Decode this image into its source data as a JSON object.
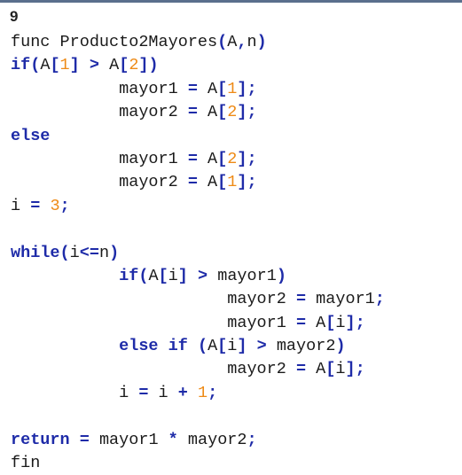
{
  "exercise_number": "9",
  "code_lines": [
    {
      "tokens": [
        {
          "t": "func Producto2Mayores",
          "c": "plain"
        },
        {
          "t": "(",
          "c": "op"
        },
        {
          "t": "A",
          "c": "plain"
        },
        {
          "t": ",",
          "c": "op"
        },
        {
          "t": "n",
          "c": "plain"
        },
        {
          "t": ")",
          "c": "op"
        }
      ]
    },
    {
      "tokens": [
        {
          "t": "if",
          "c": "kw"
        },
        {
          "t": "(",
          "c": "op"
        },
        {
          "t": "A",
          "c": "plain"
        },
        {
          "t": "[",
          "c": "op"
        },
        {
          "t": "1",
          "c": "num"
        },
        {
          "t": "]",
          "c": "op"
        },
        {
          "t": " ",
          "c": "plain"
        },
        {
          "t": ">",
          "c": "op"
        },
        {
          "t": " A",
          "c": "plain"
        },
        {
          "t": "[",
          "c": "op"
        },
        {
          "t": "2",
          "c": "num"
        },
        {
          "t": "])",
          "c": "op"
        }
      ]
    },
    {
      "tokens": [
        {
          "t": "           mayor1 ",
          "c": "plain"
        },
        {
          "t": "=",
          "c": "op"
        },
        {
          "t": " A",
          "c": "plain"
        },
        {
          "t": "[",
          "c": "op"
        },
        {
          "t": "1",
          "c": "num"
        },
        {
          "t": "];",
          "c": "op"
        }
      ]
    },
    {
      "tokens": [
        {
          "t": "           mayor2 ",
          "c": "plain"
        },
        {
          "t": "=",
          "c": "op"
        },
        {
          "t": " A",
          "c": "plain"
        },
        {
          "t": "[",
          "c": "op"
        },
        {
          "t": "2",
          "c": "num"
        },
        {
          "t": "];",
          "c": "op"
        }
      ]
    },
    {
      "tokens": [
        {
          "t": "else",
          "c": "kw"
        }
      ]
    },
    {
      "tokens": [
        {
          "t": "           mayor1 ",
          "c": "plain"
        },
        {
          "t": "=",
          "c": "op"
        },
        {
          "t": " A",
          "c": "plain"
        },
        {
          "t": "[",
          "c": "op"
        },
        {
          "t": "2",
          "c": "num"
        },
        {
          "t": "];",
          "c": "op"
        }
      ]
    },
    {
      "tokens": [
        {
          "t": "           mayor2 ",
          "c": "plain"
        },
        {
          "t": "=",
          "c": "op"
        },
        {
          "t": " A",
          "c": "plain"
        },
        {
          "t": "[",
          "c": "op"
        },
        {
          "t": "1",
          "c": "num"
        },
        {
          "t": "];",
          "c": "op"
        }
      ]
    },
    {
      "tokens": [
        {
          "t": "i ",
          "c": "plain"
        },
        {
          "t": "=",
          "c": "op"
        },
        {
          "t": " ",
          "c": "plain"
        },
        {
          "t": "3",
          "c": "num"
        },
        {
          "t": ";",
          "c": "op"
        }
      ]
    },
    {
      "tokens": []
    },
    {
      "tokens": [
        {
          "t": "while",
          "c": "kw"
        },
        {
          "t": "(",
          "c": "op"
        },
        {
          "t": "i",
          "c": "plain"
        },
        {
          "t": "<=",
          "c": "op"
        },
        {
          "t": "n",
          "c": "plain"
        },
        {
          "t": ")",
          "c": "op"
        }
      ]
    },
    {
      "tokens": [
        {
          "t": "           ",
          "c": "plain"
        },
        {
          "t": "if",
          "c": "kw"
        },
        {
          "t": "(",
          "c": "op"
        },
        {
          "t": "A",
          "c": "plain"
        },
        {
          "t": "[",
          "c": "op"
        },
        {
          "t": "i",
          "c": "plain"
        },
        {
          "t": "]",
          "c": "op"
        },
        {
          "t": " ",
          "c": "plain"
        },
        {
          "t": ">",
          "c": "op"
        },
        {
          "t": " mayor1",
          "c": "plain"
        },
        {
          "t": ")",
          "c": "op"
        }
      ]
    },
    {
      "tokens": [
        {
          "t": "                      mayor2 ",
          "c": "plain"
        },
        {
          "t": "=",
          "c": "op"
        },
        {
          "t": " mayor1",
          "c": "plain"
        },
        {
          "t": ";",
          "c": "op"
        }
      ]
    },
    {
      "tokens": [
        {
          "t": "                      mayor1 ",
          "c": "plain"
        },
        {
          "t": "=",
          "c": "op"
        },
        {
          "t": " A",
          "c": "plain"
        },
        {
          "t": "[",
          "c": "op"
        },
        {
          "t": "i",
          "c": "plain"
        },
        {
          "t": "];",
          "c": "op"
        }
      ]
    },
    {
      "tokens": [
        {
          "t": "           ",
          "c": "plain"
        },
        {
          "t": "else if",
          "c": "kw"
        },
        {
          "t": " ",
          "c": "plain"
        },
        {
          "t": "(",
          "c": "op"
        },
        {
          "t": "A",
          "c": "plain"
        },
        {
          "t": "[",
          "c": "op"
        },
        {
          "t": "i",
          "c": "plain"
        },
        {
          "t": "]",
          "c": "op"
        },
        {
          "t": " ",
          "c": "plain"
        },
        {
          "t": ">",
          "c": "op"
        },
        {
          "t": " mayor2",
          "c": "plain"
        },
        {
          "t": ")",
          "c": "op"
        }
      ]
    },
    {
      "tokens": [
        {
          "t": "                      mayor2 ",
          "c": "plain"
        },
        {
          "t": "=",
          "c": "op"
        },
        {
          "t": " A",
          "c": "plain"
        },
        {
          "t": "[",
          "c": "op"
        },
        {
          "t": "i",
          "c": "plain"
        },
        {
          "t": "];",
          "c": "op"
        }
      ]
    },
    {
      "tokens": [
        {
          "t": "           i ",
          "c": "plain"
        },
        {
          "t": "=",
          "c": "op"
        },
        {
          "t": " i ",
          "c": "plain"
        },
        {
          "t": "+",
          "c": "op"
        },
        {
          "t": " ",
          "c": "plain"
        },
        {
          "t": "1",
          "c": "num"
        },
        {
          "t": ";",
          "c": "op"
        }
      ]
    },
    {
      "tokens": []
    },
    {
      "tokens": [
        {
          "t": "return",
          "c": "kw"
        },
        {
          "t": " ",
          "c": "plain"
        },
        {
          "t": "=",
          "c": "op"
        },
        {
          "t": " mayor1 ",
          "c": "plain"
        },
        {
          "t": "*",
          "c": "op"
        },
        {
          "t": " mayor2",
          "c": "plain"
        },
        {
          "t": ";",
          "c": "op"
        }
      ]
    },
    {
      "tokens": [
        {
          "t": "fin",
          "c": "plain"
        }
      ]
    }
  ]
}
